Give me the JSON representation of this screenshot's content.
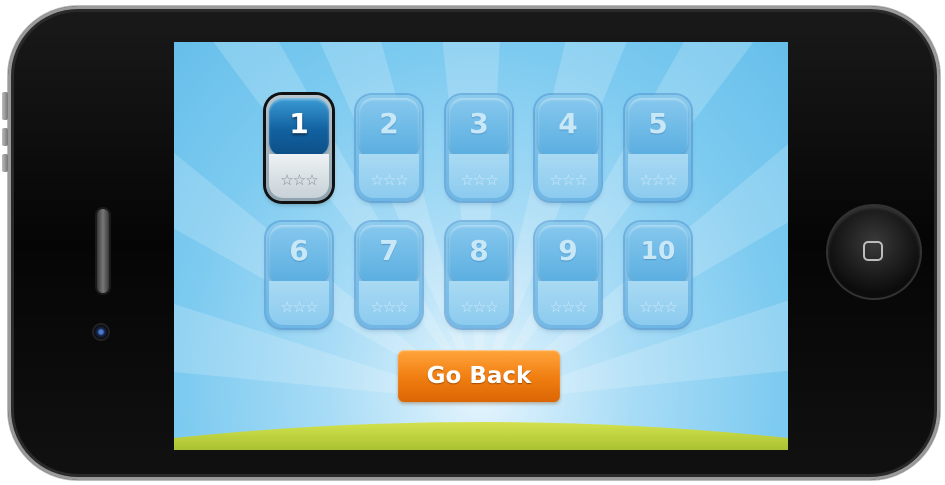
{
  "game": {
    "levels": [
      {
        "label": "1",
        "stars": "☆☆☆",
        "unlocked": true
      },
      {
        "label": "2",
        "stars": "☆☆☆",
        "unlocked": false
      },
      {
        "label": "3",
        "stars": "☆☆☆",
        "unlocked": false
      },
      {
        "label": "4",
        "stars": "☆☆☆",
        "unlocked": false
      },
      {
        "label": "5",
        "stars": "☆☆☆",
        "unlocked": false
      },
      {
        "label": "6",
        "stars": "☆☆☆",
        "unlocked": false
      },
      {
        "label": "7",
        "stars": "☆☆☆",
        "unlocked": false
      },
      {
        "label": "8",
        "stars": "☆☆☆",
        "unlocked": false
      },
      {
        "label": "9",
        "stars": "☆☆☆",
        "unlocked": false
      },
      {
        "label": "10",
        "stars": "☆☆☆",
        "unlocked": false
      }
    ],
    "go_back_label": "Go Back"
  },
  "colors": {
    "sky": "#7ccaf0",
    "tile": "#86c8ee",
    "tile_active": "#1261a0",
    "button": "#f07d10",
    "ground": "#c6d944",
    "device": "#050505"
  },
  "icons": {
    "stars": "star-outline-icon",
    "home": "home-square-icon",
    "camera": "camera-lens-icon"
  }
}
